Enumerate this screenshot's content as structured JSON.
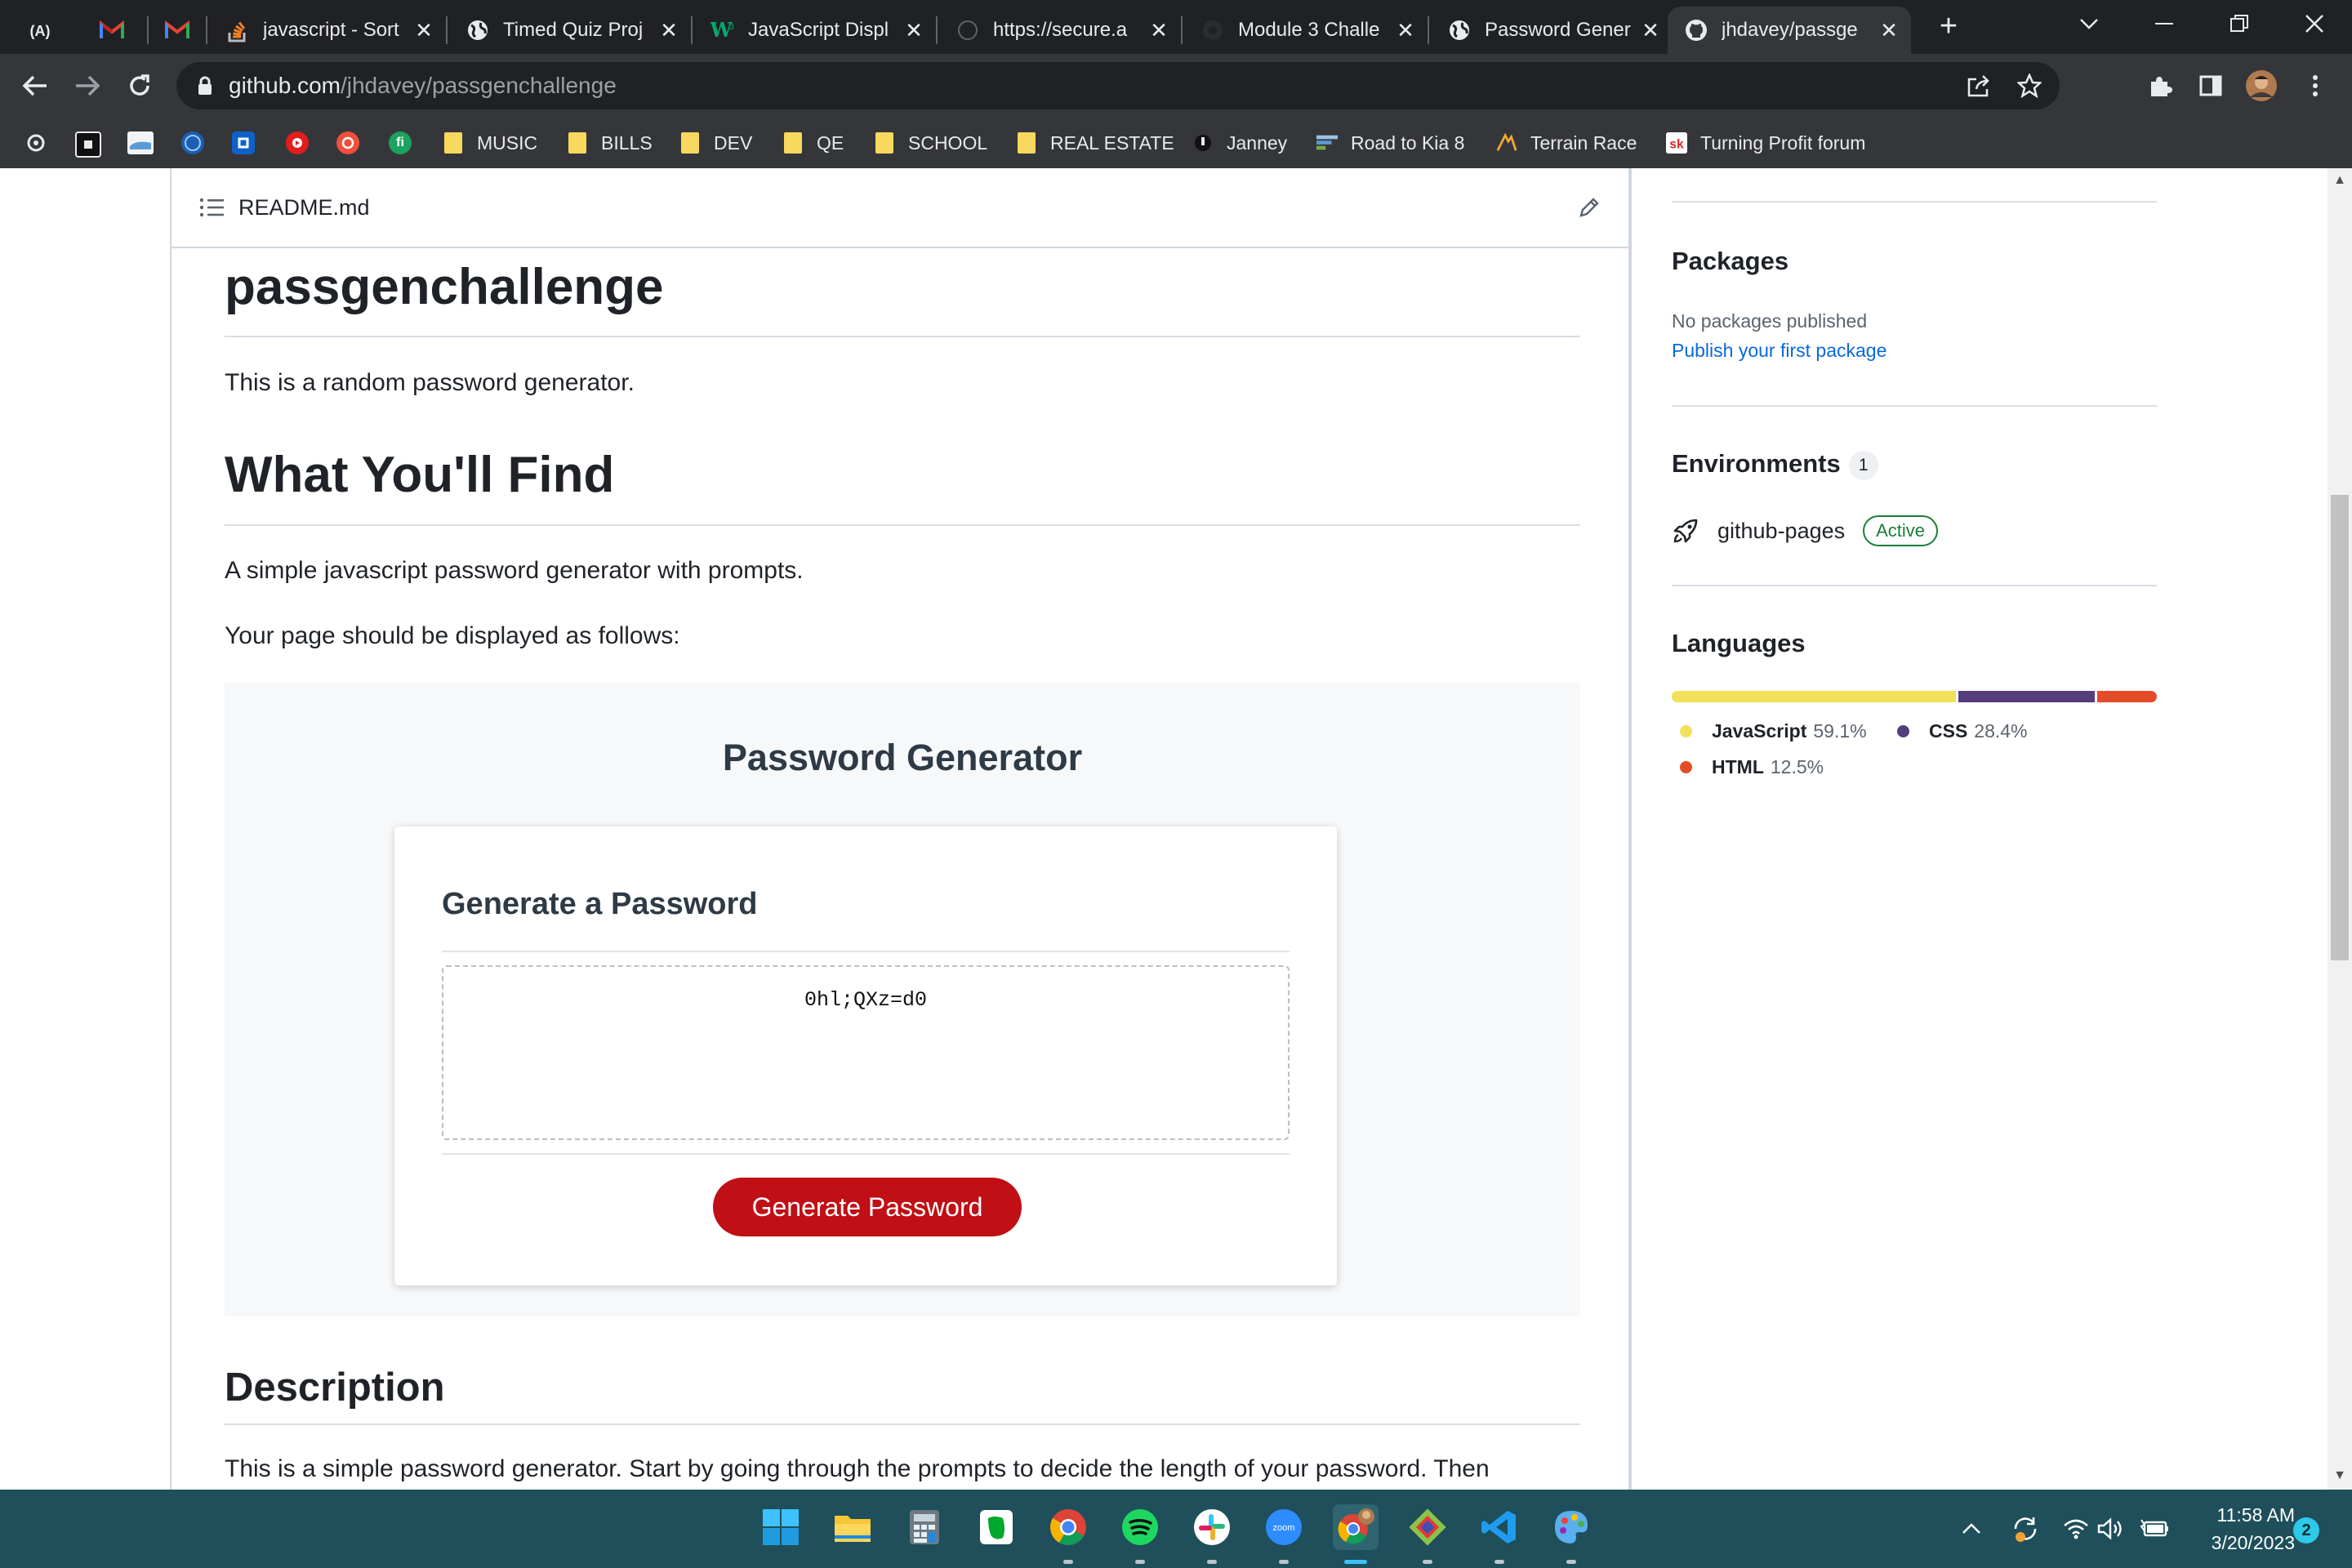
{
  "browser": {
    "tabs": [
      {
        "label": "",
        "favicon": "a-logo-icon"
      },
      {
        "label": "",
        "favicon": "gmail-icon"
      },
      {
        "label": "",
        "favicon": "gmail-icon"
      },
      {
        "label": "javascript - Sort",
        "favicon": "stackoverflow-icon"
      },
      {
        "label": "Timed Quiz Proj",
        "favicon": "globe-icon"
      },
      {
        "label": "JavaScript Displ",
        "favicon": "w3schools-icon"
      },
      {
        "label": "https://secure.a",
        "favicon": "circle-logo-icon"
      },
      {
        "label": "Module 3 Challe",
        "favicon": "canvas-icon"
      },
      {
        "label": "Password Gener",
        "favicon": "globe-icon"
      },
      {
        "label": "jhdavey/passge",
        "favicon": "github-icon",
        "active": true
      }
    ],
    "new_tab": "+",
    "url_host": "github.com",
    "url_path": "/jhdavey/passgenchallenge",
    "bookmarks": [
      "MUSIC",
      "BILLS",
      "DEV",
      "QE",
      "SCHOOL",
      "REAL ESTATE",
      "Janney",
      "Road to Kia 8",
      "Terrain Race",
      "Turning Profit forum"
    ]
  },
  "readme": {
    "filename": "README.md",
    "title": "passgenchallenge",
    "intro": "This is a random password generator.",
    "section1": "What You'll Find",
    "section1_p1": "A simple javascript password generator with prompts.",
    "section1_p2": "Your page should be displayed as follows:",
    "screenshot": {
      "title": "Password Generator",
      "card_heading": "Generate a Password",
      "password": "0hl;QXz=d0",
      "button": "Generate Password"
    },
    "section2": "Description",
    "section2_p1": "This is a simple password generator. Start by going through the prompts to decide the length of your password. Then"
  },
  "sidebar": {
    "packages_heading": "Packages",
    "packages_text": "No packages published",
    "packages_link": "Publish your first package",
    "environments_heading": "Environments",
    "environments_count": "1",
    "environment_name": "github-pages",
    "environment_status": "Active",
    "languages_heading": "Languages",
    "languages": [
      {
        "name": "JavaScript",
        "percent": "59.1%",
        "value": 59.1,
        "color": "#f1e05a"
      },
      {
        "name": "CSS",
        "percent": "28.4%",
        "value": 28.4,
        "color": "#563d7c"
      },
      {
        "name": "HTML",
        "percent": "12.5%",
        "value": 12.5,
        "color": "#e34c26"
      }
    ]
  },
  "taskbar": {
    "apps": [
      "windows-start-icon",
      "file-explorer-icon",
      "calculator-icon",
      "evernote-icon",
      "chrome-icon",
      "spotify-icon",
      "slack-icon",
      "zoom-icon",
      "chrome-profile-icon",
      "git-icon",
      "vscode-icon",
      "paint-icon"
    ],
    "zoom_label": "zoom",
    "time": "11:58 AM",
    "date": "3/20/2023",
    "notifications": "2"
  }
}
